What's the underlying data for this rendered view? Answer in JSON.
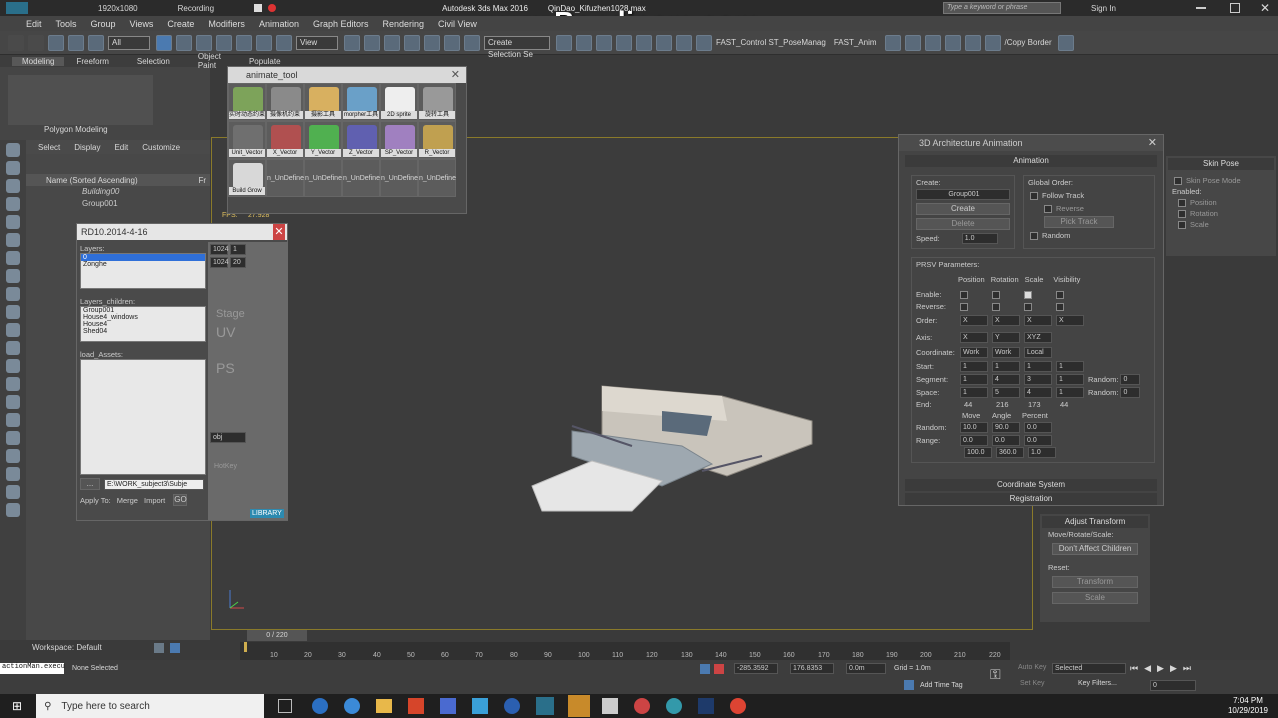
{
  "titlebar": {
    "resolution": "1920x1080",
    "recording": "Recording",
    "app_title": "Autodesk 3ds Max 2016",
    "file_name": "QinDao_Kifuzhen1028.max",
    "search_placeholder": "Type a keyword or phrase",
    "sign_in": "Sign In"
  },
  "watermark": "www.Bandicam.com",
  "menus": [
    "Edit",
    "Tools",
    "Group",
    "Views",
    "Create",
    "Modifiers",
    "Animation",
    "Graph Editors",
    "Rendering",
    "Civil View"
  ],
  "toolbar": {
    "selection_filter": "All",
    "ref_coord": "View",
    "named_selection": "Create Selection Se",
    "script_buttons": [
      "FAST_Control ST_PoseManag",
      "FAST_Anim",
      "/Copy Border"
    ]
  },
  "ribbon": {
    "tabs": [
      "Modeling",
      "Freeform",
      "Selection",
      "Object Paint",
      "Populate"
    ],
    "group_label": "Polygon Modeling"
  },
  "scene_explorer": {
    "menu": [
      "Select",
      "Display",
      "Edit",
      "Customize"
    ],
    "column": "Name (Sorted Ascending)",
    "column2": "Fr",
    "items": [
      "Building00",
      "Group001"
    ],
    "workspace": "Workspace: Default"
  },
  "animate_tool": {
    "title": "animate_tool",
    "row1": [
      "实时动态约束",
      "摄像机约束",
      "摄影工具",
      "morpher工具",
      "2D sprite",
      "旋转工具"
    ],
    "row2": [
      "Unit_Vector",
      "X_Vector",
      "Y_Vector",
      "Z_Vector",
      "SP_Vector",
      "R_Vector"
    ],
    "row3": [
      "Build Grow",
      "n_UnDefine",
      "n_UnDefine",
      "n_UnDefine",
      "n_UnDefine",
      "n_UnDefine"
    ]
  },
  "rd_panel": {
    "title": "RD10.2014-4-16",
    "layers_label": "Layers:",
    "layers": [
      "0",
      "Zonghe"
    ],
    "layers_children_label": "Layers_children:",
    "children": [
      "Group001",
      "House4_windows",
      "House4",
      "Shed04"
    ],
    "load_assets_label": "load_Assets:",
    "browse": "...",
    "path": "E:\\WORK_subject3\\Subje",
    "apply_to": "Apply To:",
    "merge": "Merge",
    "import": "Import",
    "go": "GO",
    "res1": "1024",
    "res2": "1024",
    "spin1": "1",
    "spin2": "20",
    "format": "obj",
    "labels": [
      "Stage",
      "UV",
      "PS",
      "HotKey",
      "LIBRARY"
    ]
  },
  "viewport": {
    "fps_label": "FPS:",
    "fps": "27.928",
    "time_range": "0 / 220"
  },
  "arch_anim": {
    "title": "3D Architecture Animation",
    "rollout_animation": "Animation",
    "create_label": "Create:",
    "group_name": "Group001",
    "create_btn": "Create",
    "delete_btn": "Delete",
    "speed_label": "Speed:",
    "speed": "1.0",
    "global_order": "Global Order:",
    "follow_track": "Follow Track",
    "reverse": "Reverse",
    "pick_track": "Pick Track",
    "random": "Random",
    "prsv": "PRSV Parameters:",
    "cols": [
      "Position",
      "Rotation",
      "Scale",
      "Visibility"
    ],
    "enable": "Enable:",
    "reverse_row": "Reverse:",
    "order": "Order:",
    "order_vals": [
      "X",
      "X",
      "X",
      "X"
    ],
    "axis": "Axis:",
    "axis_vals": [
      "X",
      "Y",
      "XYZ"
    ],
    "coordinate": "Coordinate:",
    "coord_vals": [
      "Work",
      "Work",
      "Local"
    ],
    "start": "Start:",
    "start_vals": [
      "1",
      "1",
      "1",
      "1"
    ],
    "segment": "Segment:",
    "segment_vals": [
      "1",
      "4",
      "3",
      "1"
    ],
    "space": "Space:",
    "space_vals": [
      "1",
      "5",
      "4",
      "1"
    ],
    "random_vals": [
      "0",
      "0"
    ],
    "random_label": "Random:",
    "end": "End:",
    "end_vals": [
      "44",
      "216",
      "173",
      "44"
    ],
    "move": "Move",
    "angle": "Angle",
    "percent": "Percent",
    "random_row": "Random:",
    "rand_vals": [
      "10.0",
      "90.0",
      "0.0"
    ],
    "range": "Range:",
    "range_vals1": [
      "0.0",
      "0.0",
      "0.0"
    ],
    "range_vals2": [
      "100.0",
      "360.0",
      "1.0"
    ],
    "coord_system": "Coordinate System",
    "registration": "Registration"
  },
  "skin_pose": {
    "title": "Skin Pose",
    "mode": "Skin Pose Mode",
    "enabled": "Enabled:",
    "position": "Position",
    "rotation": "Rotation",
    "scale": "Scale"
  },
  "adjust_transform": {
    "title": "Adjust Transform",
    "mrs": "Move/Rotate/Scale:",
    "dont_affect": "Don't Affect Children",
    "reset": "Reset:",
    "transform": "Transform",
    "scale": "Scale"
  },
  "timeline": {
    "ticks": [
      "10",
      "20",
      "30",
      "40",
      "50",
      "60",
      "70",
      "80",
      "90",
      "100",
      "110",
      "120",
      "130",
      "140",
      "150",
      "160",
      "170",
      "180",
      "190",
      "200",
      "210",
      "220"
    ]
  },
  "status": {
    "maxscript": "actionMan.execu",
    "none_selected": "None Selected",
    "x": "-285.3592",
    "y": "176.8353",
    "z": "0.0m",
    "grid": "Grid = 1.0m",
    "add_time_tag": "Add Time Tag",
    "auto_key": "Auto Key",
    "set_key": "Set Key",
    "selected": "Selected",
    "key_filters": "Key Filters...",
    "frame": "0"
  },
  "taskbar": {
    "search_placeholder": "Type here to search",
    "time": "7:04 PM",
    "date": "10/29/2019"
  }
}
